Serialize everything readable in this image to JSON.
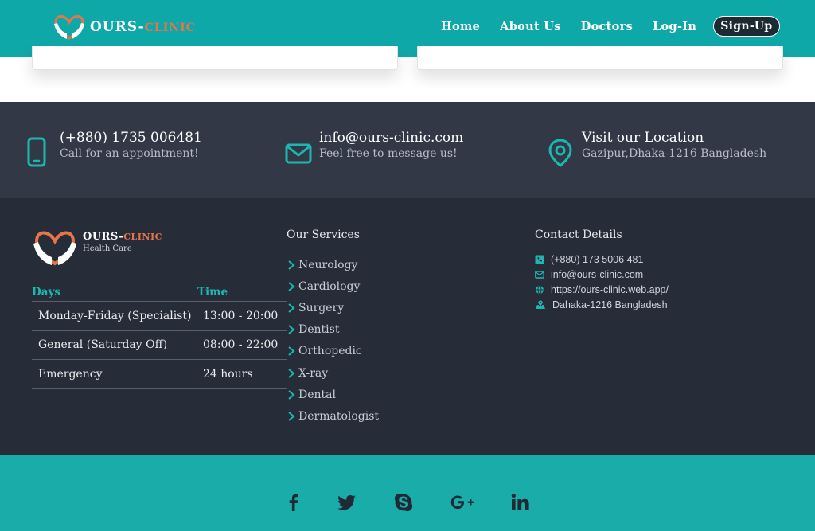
{
  "header": {
    "brand_main": "OURS",
    "brand_dash": "-",
    "brand_accent": "CLINIC",
    "nav": [
      "Home",
      "About Us",
      "Doctors",
      "Log-In"
    ],
    "signup": "Sign-Up"
  },
  "strip": {
    "phone": {
      "title": "(+880) 1735 006481",
      "sub": "Call for an appointment!"
    },
    "email": {
      "title": "info@ours-clinic.com",
      "sub": "Feel free to message us!"
    },
    "location": {
      "title": "Visit our Location",
      "sub": "Gazipur,Dhaka-1216 Bangladesh"
    }
  },
  "footer": {
    "brand_main": "OURS",
    "brand_dash": "-",
    "brand_accent": "CLINIC",
    "brand_sub": "Health Care",
    "hours_head": {
      "days": "Days",
      "time": "Time"
    },
    "hours": [
      {
        "day": "Monday-Friday (Specialist)",
        "time": "13:00 - 20:00"
      },
      {
        "day": "General (Saturday Off)",
        "time": "08:00 - 22:00"
      },
      {
        "day": "Emergency",
        "time": "24 hours"
      }
    ],
    "services_title": "Our Services",
    "services": [
      "Neurology",
      "Cardiology",
      "Surgery",
      "Dentist",
      "Orthopedic",
      "X-ray",
      "Dental",
      "Dermatologist"
    ],
    "contact_title": "Contact Details",
    "contact": {
      "phone": "(+880) 173 5006 481",
      "email": "info@ours-clinic.com",
      "web": "https://ours-clinic.web.app/",
      "address": "Dahaka-1216 Bangladesh"
    }
  },
  "social": [
    "facebook-icon",
    "twitter-icon",
    "skype-icon",
    "google-plus-icon",
    "linkedin-icon"
  ],
  "colors": {
    "header_bg": "#0fa8a8",
    "strip_bg": "#323846",
    "footer_bg": "#272c39",
    "social_bg": "#1aaca8",
    "accent_orange": "#e8744a",
    "accent_teal": "#1eb6b0"
  }
}
